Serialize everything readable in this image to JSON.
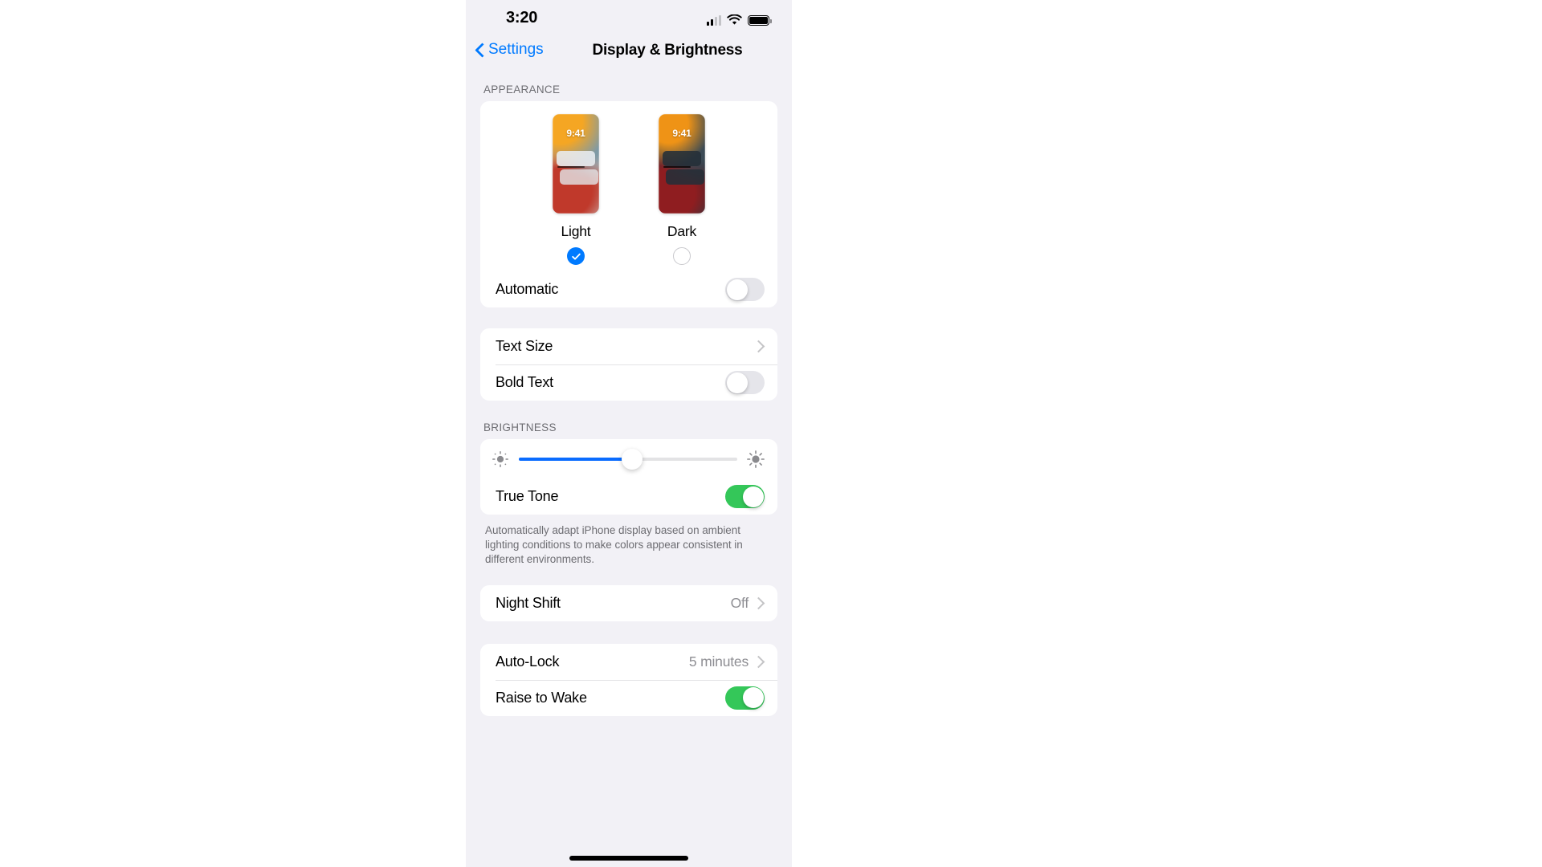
{
  "status_bar": {
    "time": "3:20",
    "cellular_icon": "cellular-signal-icon",
    "wifi_icon": "wifi-icon",
    "battery_icon": "battery-full-icon"
  },
  "nav": {
    "back_label": "Settings",
    "back_icon": "chevron-left-icon",
    "title": "Display & Brightness"
  },
  "appearance": {
    "header": "APPEARANCE",
    "options": [
      {
        "label": "Light",
        "selected": true,
        "preview_time": "9:41"
      },
      {
        "label": "Dark",
        "selected": false,
        "preview_time": "9:41"
      }
    ],
    "automatic": {
      "label": "Automatic",
      "state": "off"
    }
  },
  "text_group": {
    "text_size": {
      "label": "Text Size",
      "accessory": "chevron-right-icon"
    },
    "bold_text": {
      "label": "Bold Text",
      "state": "off"
    }
  },
  "brightness": {
    "header": "BRIGHTNESS",
    "low_icon": "brightness-low-icon",
    "high_icon": "brightness-high-icon",
    "value_percent": 52,
    "true_tone": {
      "label": "True Tone",
      "state": "on"
    },
    "footnote": "Automatically adapt iPhone display based on ambient lighting conditions to make colors appear consistent in different environments."
  },
  "night_shift": {
    "label": "Night Shift",
    "value": "Off",
    "accessory": "chevron-right-icon"
  },
  "lock_group": {
    "auto_lock": {
      "label": "Auto-Lock",
      "value": "5 minutes",
      "accessory": "chevron-right-icon"
    },
    "raise_to_wake": {
      "label": "Raise to Wake",
      "state": "on"
    }
  },
  "colors": {
    "accent_blue": "#007aff",
    "toggle_on_green": "#34c759",
    "slider_blue": "#0a6cff",
    "page_background": "#f2f1f6"
  }
}
